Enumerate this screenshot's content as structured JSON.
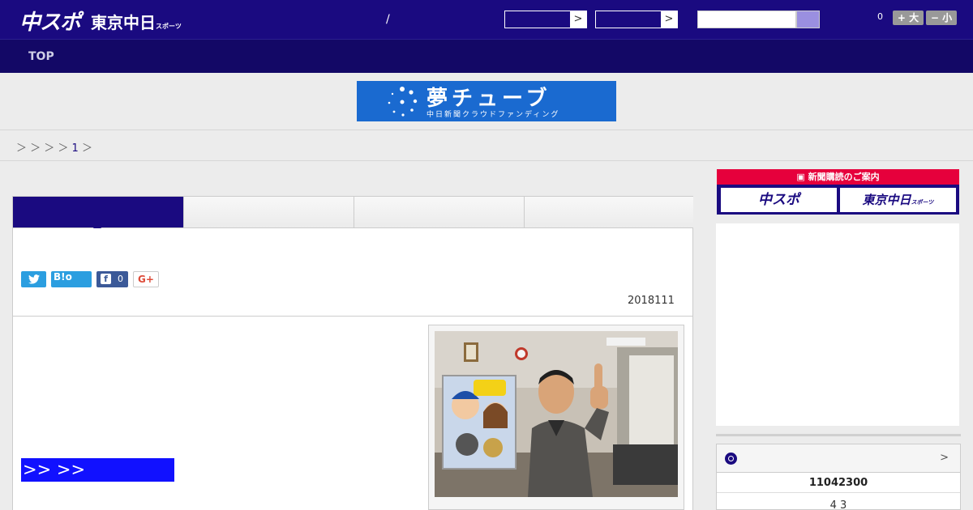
{
  "header": {
    "logo_primary": "中スポ",
    "logo_secondary": "東京中日",
    "logo_secondary_sub": "スポーツ",
    "slash": "/",
    "select_arrow": ">",
    "count": "0",
    "font_larger": "+ 大",
    "font_smaller": "− 小"
  },
  "nav": {
    "top_label": "TOP"
  },
  "banner": {
    "title": "夢チューブ",
    "subtitle": "中日新聞クラウドファンディング"
  },
  "breadcrumb": {
    "separators": "＞ ＞ ＞ ＞",
    "page_number": "1",
    "trailing": "＞"
  },
  "article": {
    "share": {
      "twitter": "",
      "hatena": "B!o",
      "facebook_count": "0",
      "gplus": "G+"
    },
    "date": "2018111",
    "blue_link": ">> >>"
  },
  "sidebar": {
    "subscribe_heading": "新聞購読のご案内",
    "subscribe_chuspo": "中スポ",
    "subscribe_tokyo": "東京中日",
    "subscribe_tokyo_sub": "スポーツ",
    "score_arrow": ">",
    "score_line1": "11042300",
    "score_line2": "4  3"
  },
  "colors": {
    "brand_navy": "#1a0a80",
    "nav_dark": "#130866",
    "banner_blue": "#1a6ad0",
    "subscribe_red": "#e6003c",
    "link_blue": "#1111ff"
  }
}
